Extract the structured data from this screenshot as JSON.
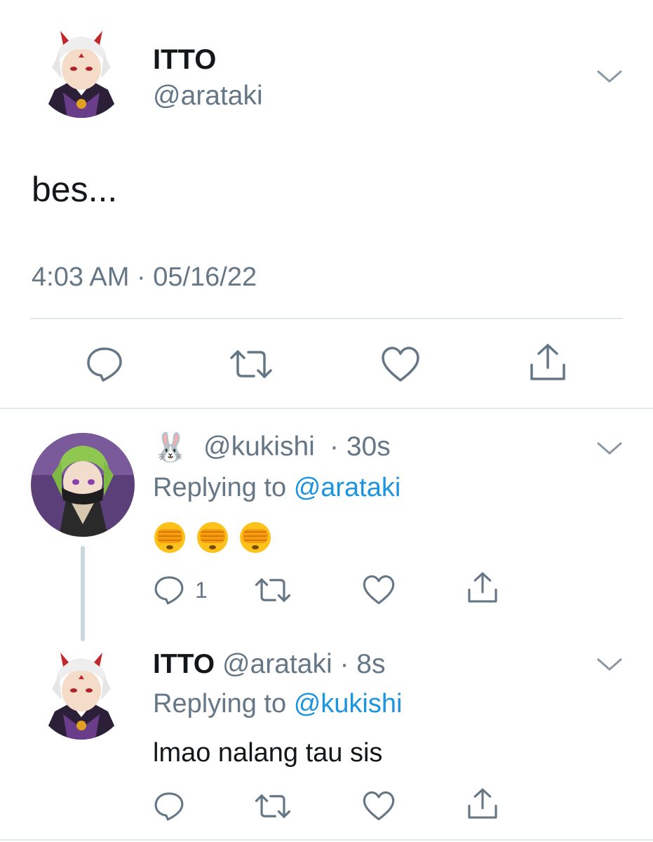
{
  "main_tweet": {
    "display_name": "ITTO",
    "handle": "@arataki",
    "text": "bes...",
    "timestamp": "4:03 AM · 05/16/22",
    "actions": [
      "reply-icon",
      "retweet-icon",
      "like-icon",
      "share-icon"
    ]
  },
  "reply1": {
    "name_emoji": "🐰",
    "handle": "@kukishi",
    "time": "· 30s",
    "replying_label": "Replying to",
    "replying_handle": "@arataki",
    "emojis": [
      "🫣",
      "🫣",
      "🫣"
    ],
    "reply_count": "1"
  },
  "reply2": {
    "display_name": "ITTO",
    "handle": "@arataki",
    "time": "· 8s",
    "replying_label": "Replying to",
    "replying_handle": "@kukishi",
    "text": "lmao nalang tau sis"
  },
  "colors": {
    "text": "#14171a",
    "gray": "#657786",
    "link": "#1b95e0",
    "divider": "#e1e8ed",
    "thread_line": "#ccd6dd"
  }
}
